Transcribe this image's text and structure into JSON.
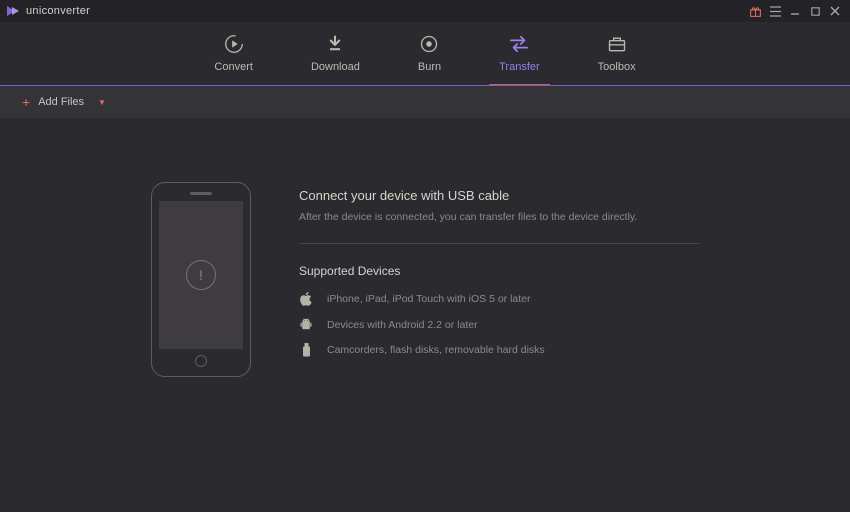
{
  "app": {
    "title": "uniconverter"
  },
  "tabs": {
    "convert": "Convert",
    "download": "Download",
    "burn": "Burn",
    "transfer": "Transfer",
    "toolbox": "Toolbox"
  },
  "toolbar": {
    "add_files": "Add Files"
  },
  "transfer": {
    "title": "Connect your device with USB cable",
    "subtitle": "After the device is connected, you can transfer files to the device directly.",
    "supported_title": "Supported Devices",
    "devices": {
      "apple": "iPhone, iPad, iPod Touch with iOS 5 or later",
      "android": "Devices with Android 2.2 or later",
      "storage": "Camcorders, flash disks, removable hard disks"
    }
  }
}
